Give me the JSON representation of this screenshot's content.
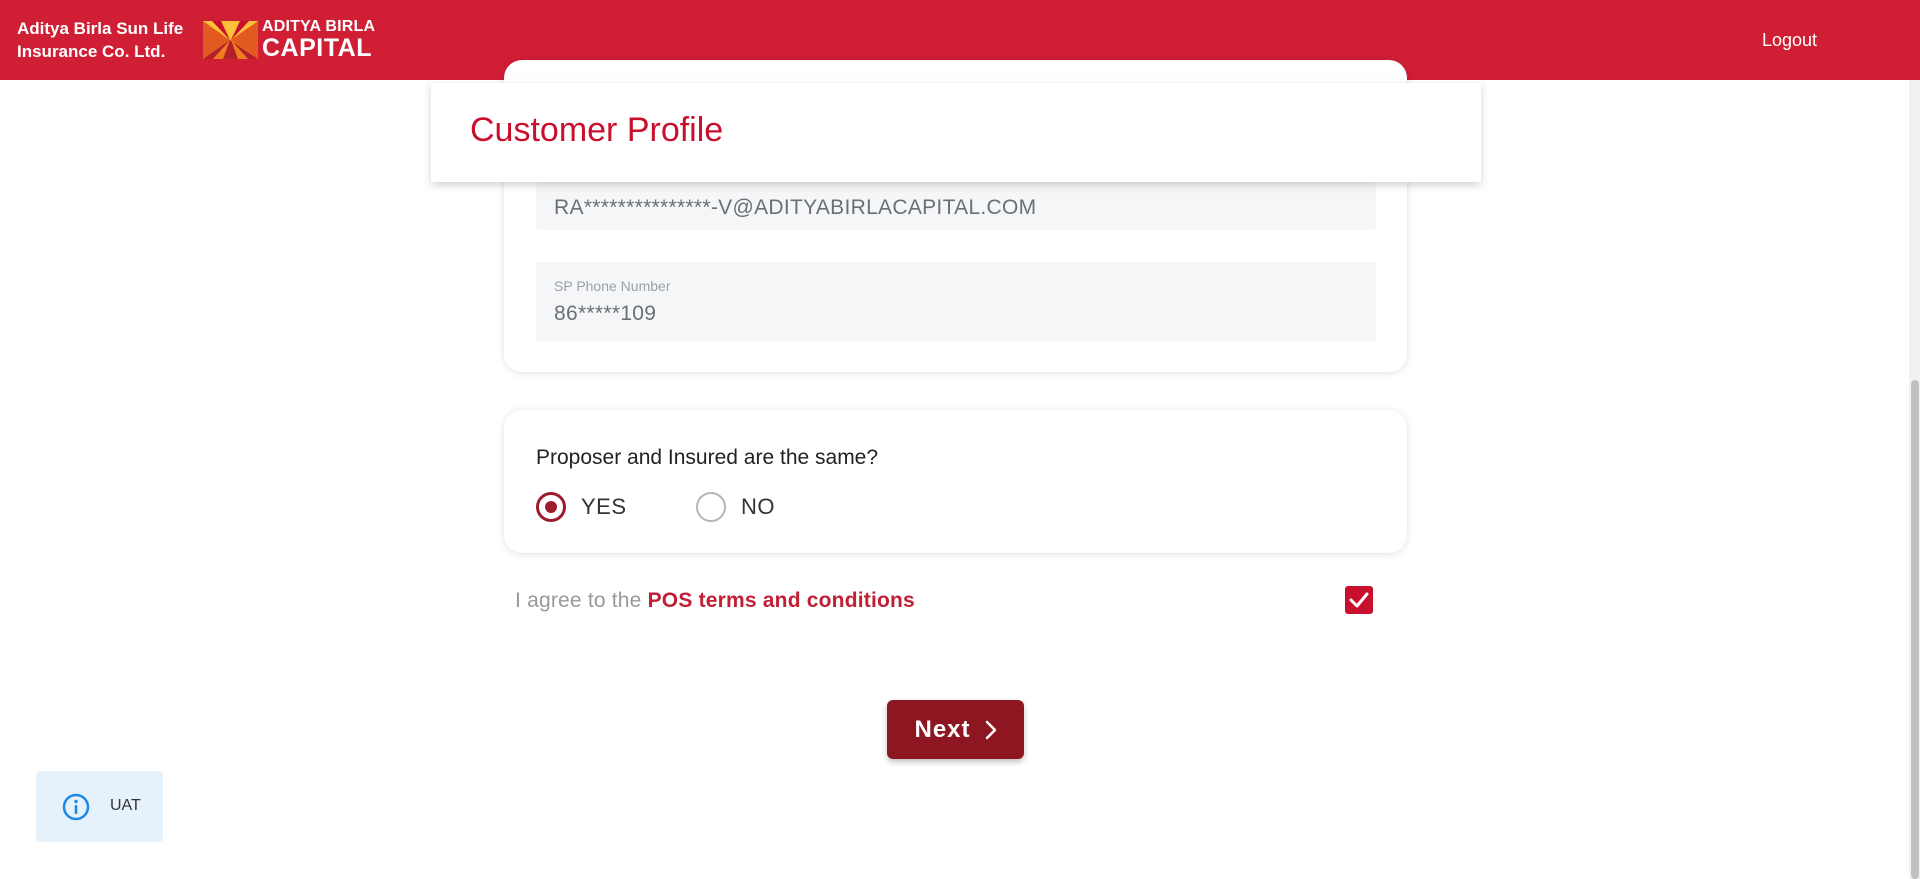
{
  "header": {
    "company_line1": "Aditya Birla Sun Life",
    "company_line2": "Insurance Co. Ltd.",
    "logo_line1": "ADITYA BIRLA",
    "logo_line2": "CAPITAL",
    "logout_label": "Logout",
    "bar_color": "#d01e35"
  },
  "page_title": "Customer Profile",
  "contact_card": {
    "email_value": "RA***************-V@ADITYABIRLACAPITAL.COM",
    "phone_label": "SP Phone Number",
    "phone_value": "86*****109"
  },
  "proposer_card": {
    "question": "Proposer and Insured are the same?",
    "options": [
      {
        "label": "YES",
        "selected": true
      },
      {
        "label": "NO",
        "selected": false
      }
    ]
  },
  "agreement": {
    "prefix": "I agree to the ",
    "link_text": "POS terms and conditions",
    "checked": true
  },
  "next_button": {
    "label": "Next",
    "icon": "chevron-right-icon"
  },
  "env_badge": {
    "label": "UAT",
    "icon": "info-icon"
  },
  "colors": {
    "brand_red": "#c8102e",
    "button_dark_red": "#8e1620",
    "radio_selected": "#9b1c2b"
  }
}
